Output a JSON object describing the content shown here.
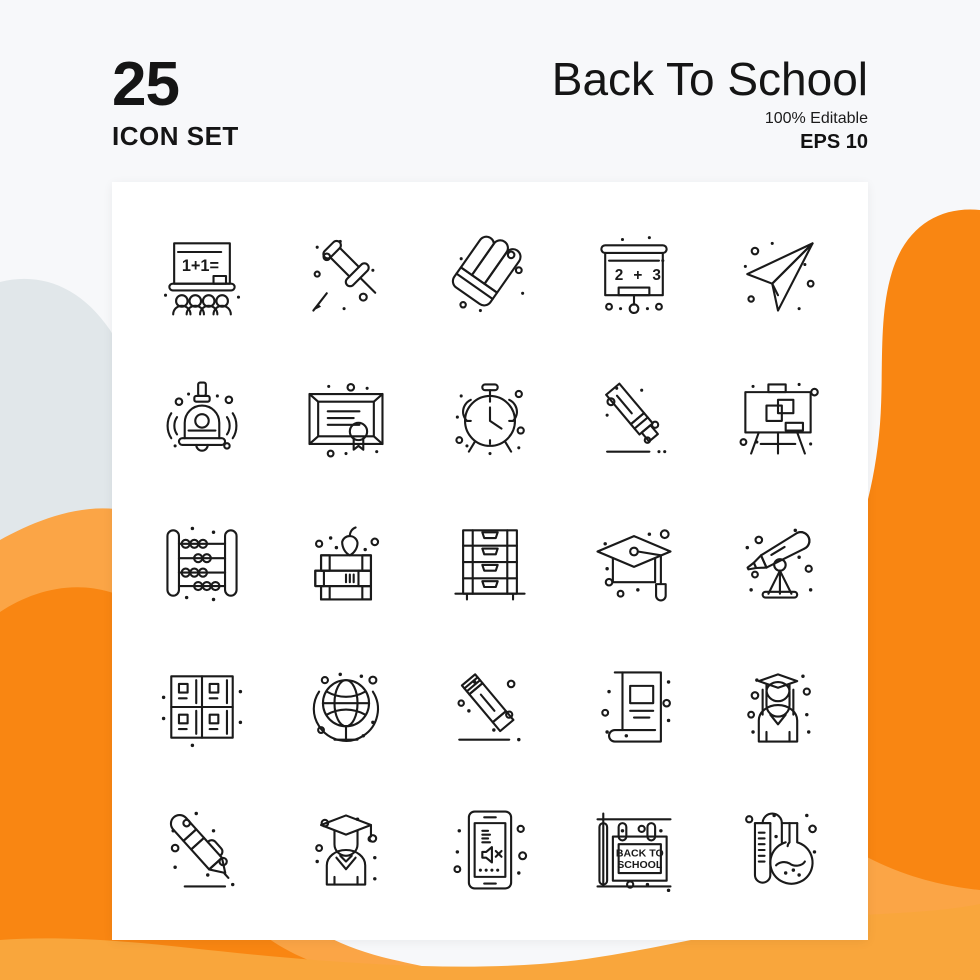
{
  "header": {
    "count": "25",
    "count_caption": "ICON SET",
    "title": "Back To School",
    "editable_note": "100% Editable",
    "format_note": "EPS 10"
  },
  "theme": {
    "page_background": "#f7f8fa",
    "card_background": "#ffffff",
    "orange_dark": "#f98612",
    "orange_light": "#f9a council",
    "orange_light_real": "#fba546",
    "gray_blob": "#e1e7ea",
    "stroke": "#1a1a1a"
  },
  "icons": [
    {
      "row": 1,
      "col": 1,
      "name": "blackboard-classroom-icon",
      "label": "Blackboard with students",
      "text": "1+1="
    },
    {
      "row": 1,
      "col": 2,
      "name": "push-pin-icon",
      "label": "Push pin"
    },
    {
      "row": 1,
      "col": 3,
      "name": "shuttlecock-icon",
      "label": "Badminton shuttlecock"
    },
    {
      "row": 1,
      "col": 4,
      "name": "presentation-board-icon",
      "label": "Presentation board",
      "text": "2 + 3"
    },
    {
      "row": 1,
      "col": 5,
      "name": "paper-plane-icon",
      "label": "Paper plane"
    },
    {
      "row": 2,
      "col": 1,
      "name": "school-bell-icon",
      "label": "Ringing bell"
    },
    {
      "row": 2,
      "col": 2,
      "name": "certificate-icon",
      "label": "Framed certificate"
    },
    {
      "row": 2,
      "col": 3,
      "name": "alarm-clock-icon",
      "label": "Alarm clock"
    },
    {
      "row": 2,
      "col": 4,
      "name": "highlighter-marker-icon",
      "label": "Highlighter marker"
    },
    {
      "row": 2,
      "col": 5,
      "name": "easel-board-icon",
      "label": "Easel whiteboard"
    },
    {
      "row": 3,
      "col": 1,
      "name": "abacus-icon",
      "label": "Abacus"
    },
    {
      "row": 3,
      "col": 2,
      "name": "books-apple-icon",
      "label": "Stack of books with apple"
    },
    {
      "row": 3,
      "col": 3,
      "name": "drawer-cabinet-icon",
      "label": "Drawer cabinet"
    },
    {
      "row": 3,
      "col": 4,
      "name": "graduation-cap-icon",
      "label": "Graduation cap"
    },
    {
      "row": 3,
      "col": 5,
      "name": "telescope-icon",
      "label": "Telescope"
    },
    {
      "row": 4,
      "col": 1,
      "name": "lockers-icon",
      "label": "School lockers"
    },
    {
      "row": 4,
      "col": 2,
      "name": "globe-stand-icon",
      "label": "Globe on stand"
    },
    {
      "row": 4,
      "col": 3,
      "name": "pencil-eraser-icon",
      "label": "Pencil with eraser"
    },
    {
      "row": 4,
      "col": 4,
      "name": "textbook-icon",
      "label": "Textbook"
    },
    {
      "row": 4,
      "col": 5,
      "name": "female-graduate-icon",
      "label": "Female graduate"
    },
    {
      "row": 5,
      "col": 1,
      "name": "pen-writing-icon",
      "label": "Pen writing"
    },
    {
      "row": 5,
      "col": 2,
      "name": "male-graduate-icon",
      "label": "Male graduate"
    },
    {
      "row": 5,
      "col": 3,
      "name": "phone-silent-icon",
      "label": "Phone silent mode"
    },
    {
      "row": 5,
      "col": 4,
      "name": "back-to-school-sign-icon",
      "label": "Hanging sign",
      "text_line1": "BACK TO",
      "text_line2": "SCHOOL"
    },
    {
      "row": 5,
      "col": 5,
      "name": "lab-flask-icon",
      "label": "Test tube and flask"
    }
  ]
}
